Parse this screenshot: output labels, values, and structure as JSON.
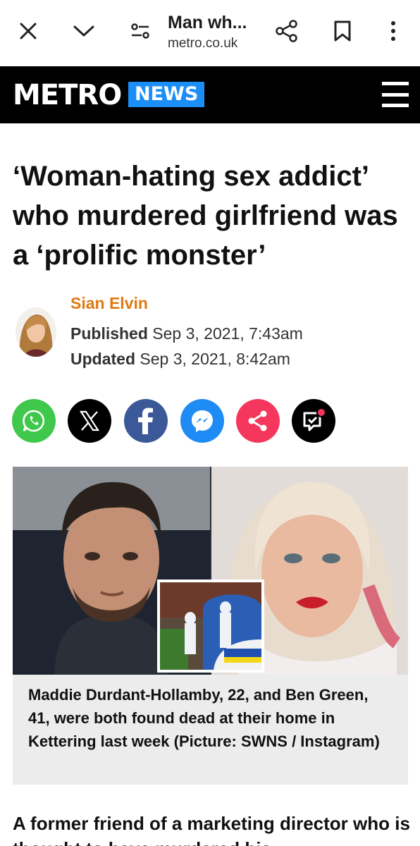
{
  "browser": {
    "title": "Man wh...",
    "domain": "metro.co.uk",
    "icons": [
      "close-icon",
      "chevron-down-icon",
      "page-settings-icon",
      "share-icon",
      "bookmark-icon",
      "more-vert-icon"
    ]
  },
  "site": {
    "logo": "METRO",
    "section": "NEWS",
    "accent": "#1c8ef7"
  },
  "article": {
    "headline": "‘Woman-hating sex addict’ who murdered girlfriend was a ‘prolific monster’",
    "author": "Sian Elvin",
    "published_label": "Published",
    "published_value": "Sep 3, 2021, 7:43am",
    "updated_label": "Updated",
    "updated_value": "Sep 3, 2021, 8:42am",
    "caption": "Maddie Durdant-Hollamby, 22, and Ben Green, 41, were both found dead at their home in Kettering last week (Picture: SWNS / Instagram)",
    "body_start": "A former friend of a marketing director who is thought to have murdered his"
  },
  "share": [
    {
      "name": "whatsapp",
      "color": "#3fc84c"
    },
    {
      "name": "x",
      "color": "#000000"
    },
    {
      "name": "facebook",
      "color": "#3b5998"
    },
    {
      "name": "messenger",
      "color": "#1f8cf6"
    },
    {
      "name": "share",
      "color": "#f5375d"
    },
    {
      "name": "comments",
      "color": "#000000"
    }
  ]
}
